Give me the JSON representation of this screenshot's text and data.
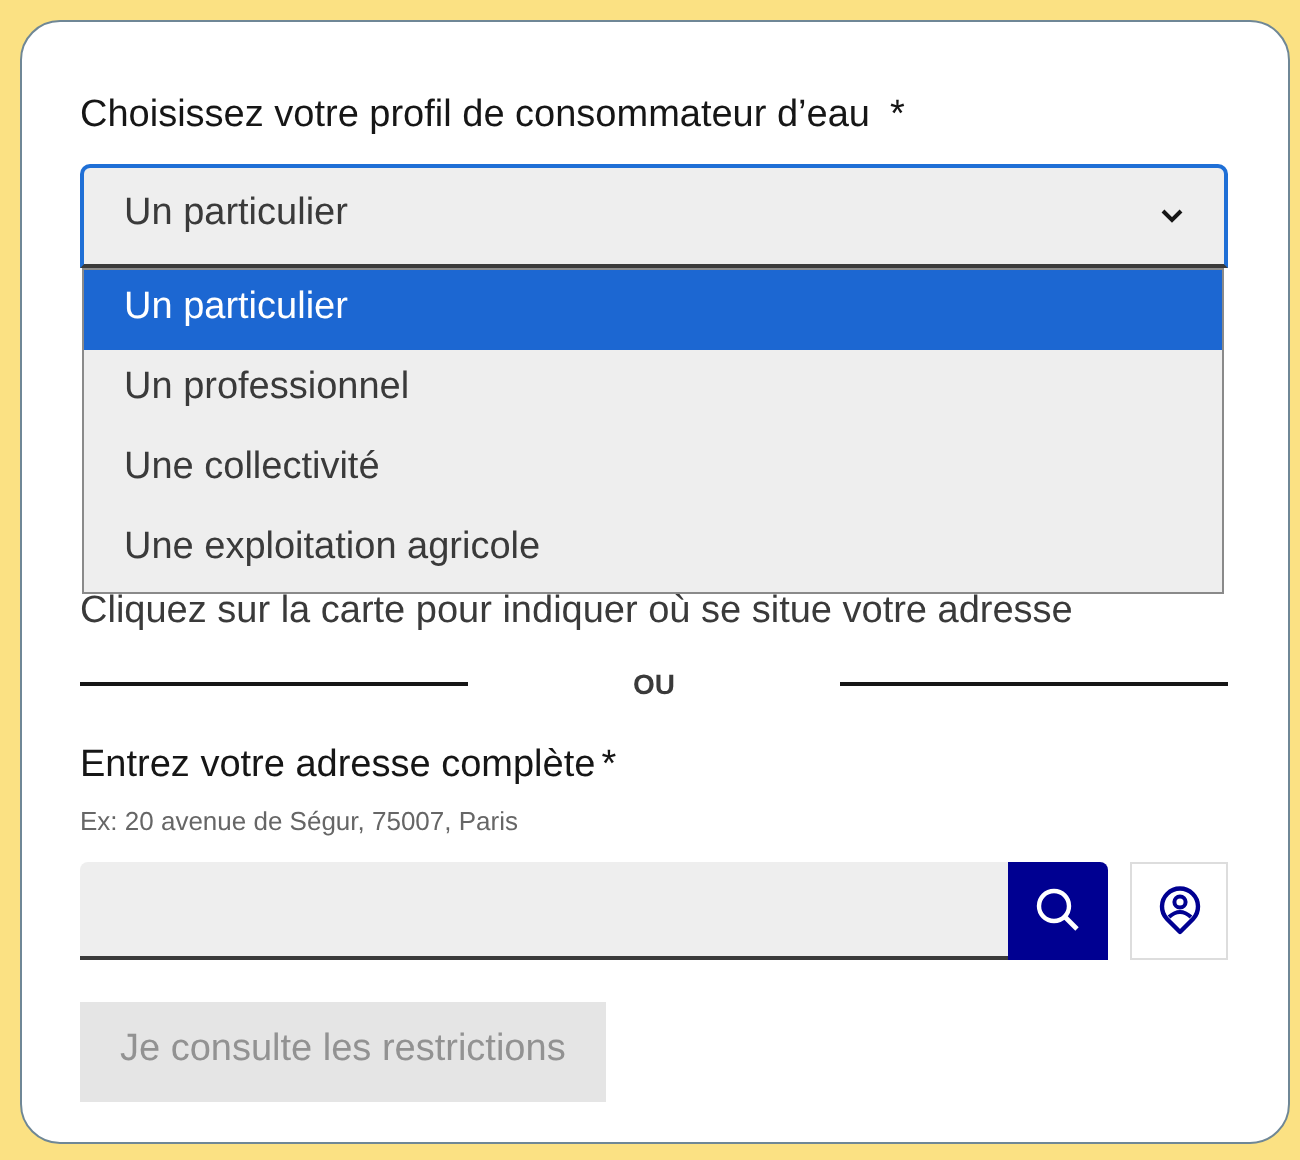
{
  "profile_select": {
    "label": "Choisissez votre profil de consommateur d’eau",
    "required_mark": "*",
    "value": "Un particulier",
    "expanded": true,
    "options": [
      {
        "label": "Un particulier",
        "selected": true
      },
      {
        "label": "Un professionnel",
        "selected": false
      },
      {
        "label": "Une collectivité",
        "selected": false
      },
      {
        "label": "Une exploitation agricole",
        "selected": false
      }
    ]
  },
  "map_hint": "Cliquez sur la carte pour indiquer où se situe votre adresse",
  "separator": "OU",
  "address": {
    "label": "Entrez votre adresse complète",
    "required_mark": "*",
    "hint": "Ex: 20 avenue de Ségur, 75007, Paris"
  },
  "submit_button": {
    "label": "Je consulte les restrictions",
    "disabled": true
  }
}
